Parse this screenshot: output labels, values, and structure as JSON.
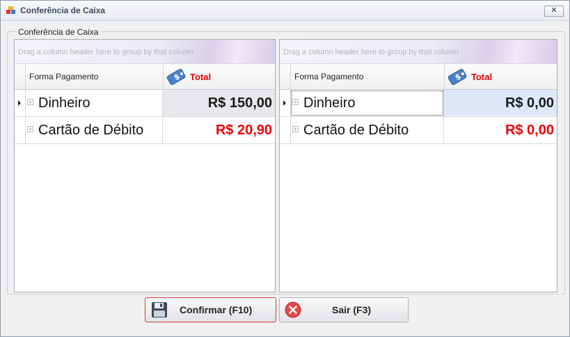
{
  "window": {
    "title": "Conferência de Caixa",
    "close_label": "✕"
  },
  "group": {
    "title": "Conferência de Caixa"
  },
  "left_grid": {
    "group_hint": "Drag a column header here to group by that column",
    "columns": {
      "forma": "Forma Pagamento",
      "total": "Total"
    },
    "rows": [
      {
        "forma": "Dinheiro",
        "total": "R$ 150,00",
        "color": "#1a1a1a",
        "selected": true
      },
      {
        "forma": "Cartão de Débito",
        "total": "R$ 20,90",
        "color": "#ee0000",
        "selected": false
      }
    ]
  },
  "right_grid": {
    "group_hint": "Drag a column header here to group by that column",
    "columns": {
      "forma": "Forma Pagamento",
      "total": "Total"
    },
    "rows": [
      {
        "forma": "Dinheiro",
        "total": "R$ 0,00",
        "color": "#1a1a1a",
        "selected": true
      },
      {
        "forma": "Cartão de Débito",
        "total": "R$ 0,00",
        "color": "#ee0000",
        "selected": false
      }
    ]
  },
  "buttons": {
    "confirm": "Confirmar (F10)",
    "exit": "Sair (F3)"
  },
  "icons": {
    "save": "floppy-disk-icon",
    "exit": "red-x-circle-icon",
    "money_tag": "price-tag-icon"
  },
  "colors": {
    "accent_red": "#ee0000",
    "selected_cell": "#e6e8eb",
    "selected_cell_right": "#dfe8fb"
  }
}
